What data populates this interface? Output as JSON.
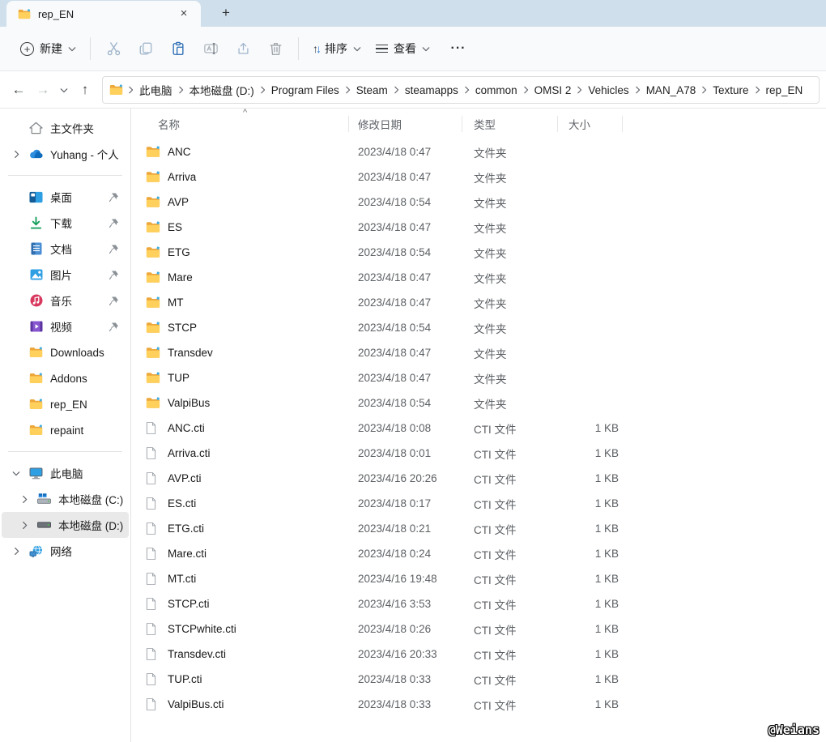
{
  "window": {
    "tab_title": "rep_EN",
    "glyphs": {
      "close": "×",
      "new_tab": "+",
      "back": "←",
      "forward": "→",
      "up": "↑",
      "plus": "+",
      "more": "···",
      "sort_caret": "^",
      "sort_up": "↑",
      "sort_down": "↓"
    }
  },
  "toolbar": {
    "new_label": "新建",
    "sort_label": "排序",
    "view_label": "查看"
  },
  "breadcrumb": {
    "items": [
      "此电脑",
      "本地磁盘 (D:)",
      "Program Files",
      "Steam",
      "steamapps",
      "common",
      "OMSI 2",
      "Vehicles",
      "MAN_A78",
      "Texture",
      "rep_EN"
    ]
  },
  "sidebar": {
    "home": {
      "label": "主文件夹",
      "icon": "home-icon"
    },
    "onedrive": {
      "label": "Yuhang - 个人",
      "icon": "onedrive-cloud-icon"
    },
    "quick": [
      {
        "label": "桌面",
        "icon": "desktop-icon",
        "pinned": true
      },
      {
        "label": "下载",
        "icon": "downloads-icon",
        "pinned": true
      },
      {
        "label": "文档",
        "icon": "documents-icon",
        "pinned": true
      },
      {
        "label": "图片",
        "icon": "pictures-icon",
        "pinned": true
      },
      {
        "label": "音乐",
        "icon": "music-icon",
        "pinned": true
      },
      {
        "label": "视频",
        "icon": "videos-icon",
        "pinned": true
      }
    ],
    "folders": [
      {
        "label": "Downloads"
      },
      {
        "label": "Addons"
      },
      {
        "label": "rep_EN"
      },
      {
        "label": "repaint"
      }
    ],
    "tree": {
      "this_pc": "此电脑",
      "drive_c": "本地磁盘 (C:)",
      "drive_d": "本地磁盘 (D:)",
      "network": "网络",
      "selected": "drive_d"
    }
  },
  "columns": {
    "name": "名称",
    "date": "修改日期",
    "type": "类型",
    "size": "大小"
  },
  "files": {
    "rows": [
      {
        "name": "ANC",
        "date": "2023/4/18 0:47",
        "type": "文件夹",
        "size": "",
        "kind": "folder"
      },
      {
        "name": "Arriva",
        "date": "2023/4/18 0:47",
        "type": "文件夹",
        "size": "",
        "kind": "folder"
      },
      {
        "name": "AVP",
        "date": "2023/4/18 0:54",
        "type": "文件夹",
        "size": "",
        "kind": "folder"
      },
      {
        "name": "ES",
        "date": "2023/4/18 0:47",
        "type": "文件夹",
        "size": "",
        "kind": "folder"
      },
      {
        "name": "ETG",
        "date": "2023/4/18 0:54",
        "type": "文件夹",
        "size": "",
        "kind": "folder"
      },
      {
        "name": "Mare",
        "date": "2023/4/18 0:47",
        "type": "文件夹",
        "size": "",
        "kind": "folder"
      },
      {
        "name": "MT",
        "date": "2023/4/18 0:47",
        "type": "文件夹",
        "size": "",
        "kind": "folder"
      },
      {
        "name": "STCP",
        "date": "2023/4/18 0:54",
        "type": "文件夹",
        "size": "",
        "kind": "folder"
      },
      {
        "name": "Transdev",
        "date": "2023/4/18 0:47",
        "type": "文件夹",
        "size": "",
        "kind": "folder"
      },
      {
        "name": "TUP",
        "date": "2023/4/18 0:47",
        "type": "文件夹",
        "size": "",
        "kind": "folder"
      },
      {
        "name": "ValpiBus",
        "date": "2023/4/18 0:54",
        "type": "文件夹",
        "size": "",
        "kind": "folder"
      },
      {
        "name": "ANC.cti",
        "date": "2023/4/18 0:08",
        "type": "CTI 文件",
        "size": "1 KB",
        "kind": "file"
      },
      {
        "name": "Arriva.cti",
        "date": "2023/4/18 0:01",
        "type": "CTI 文件",
        "size": "1 KB",
        "kind": "file"
      },
      {
        "name": "AVP.cti",
        "date": "2023/4/16 20:26",
        "type": "CTI 文件",
        "size": "1 KB",
        "kind": "file"
      },
      {
        "name": "ES.cti",
        "date": "2023/4/18 0:17",
        "type": "CTI 文件",
        "size": "1 KB",
        "kind": "file"
      },
      {
        "name": "ETG.cti",
        "date": "2023/4/18 0:21",
        "type": "CTI 文件",
        "size": "1 KB",
        "kind": "file"
      },
      {
        "name": "Mare.cti",
        "date": "2023/4/18 0:24",
        "type": "CTI 文件",
        "size": "1 KB",
        "kind": "file"
      },
      {
        "name": "MT.cti",
        "date": "2023/4/16 19:48",
        "type": "CTI 文件",
        "size": "1 KB",
        "kind": "file"
      },
      {
        "name": "STCP.cti",
        "date": "2023/4/16 3:53",
        "type": "CTI 文件",
        "size": "1 KB",
        "kind": "file"
      },
      {
        "name": "STCPwhite.cti",
        "date": "2023/4/18 0:26",
        "type": "CTI 文件",
        "size": "1 KB",
        "kind": "file"
      },
      {
        "name": "Transdev.cti",
        "date": "2023/4/16 20:33",
        "type": "CTI 文件",
        "size": "1 KB",
        "kind": "file"
      },
      {
        "name": "TUP.cti",
        "date": "2023/4/18 0:33",
        "type": "CTI 文件",
        "size": "1 KB",
        "kind": "file"
      },
      {
        "name": "ValpiBus.cti",
        "date": "2023/4/18 0:33",
        "type": "CTI 文件",
        "size": "1 KB",
        "kind": "file"
      }
    ]
  },
  "watermark": "@Weians",
  "colors": {
    "accent": "#0f6cbd",
    "tabstrip": "#cfdfeb",
    "folder_front": "#ffd05c",
    "folder_back": "#eda73b",
    "selection": "#e9e9e9"
  }
}
